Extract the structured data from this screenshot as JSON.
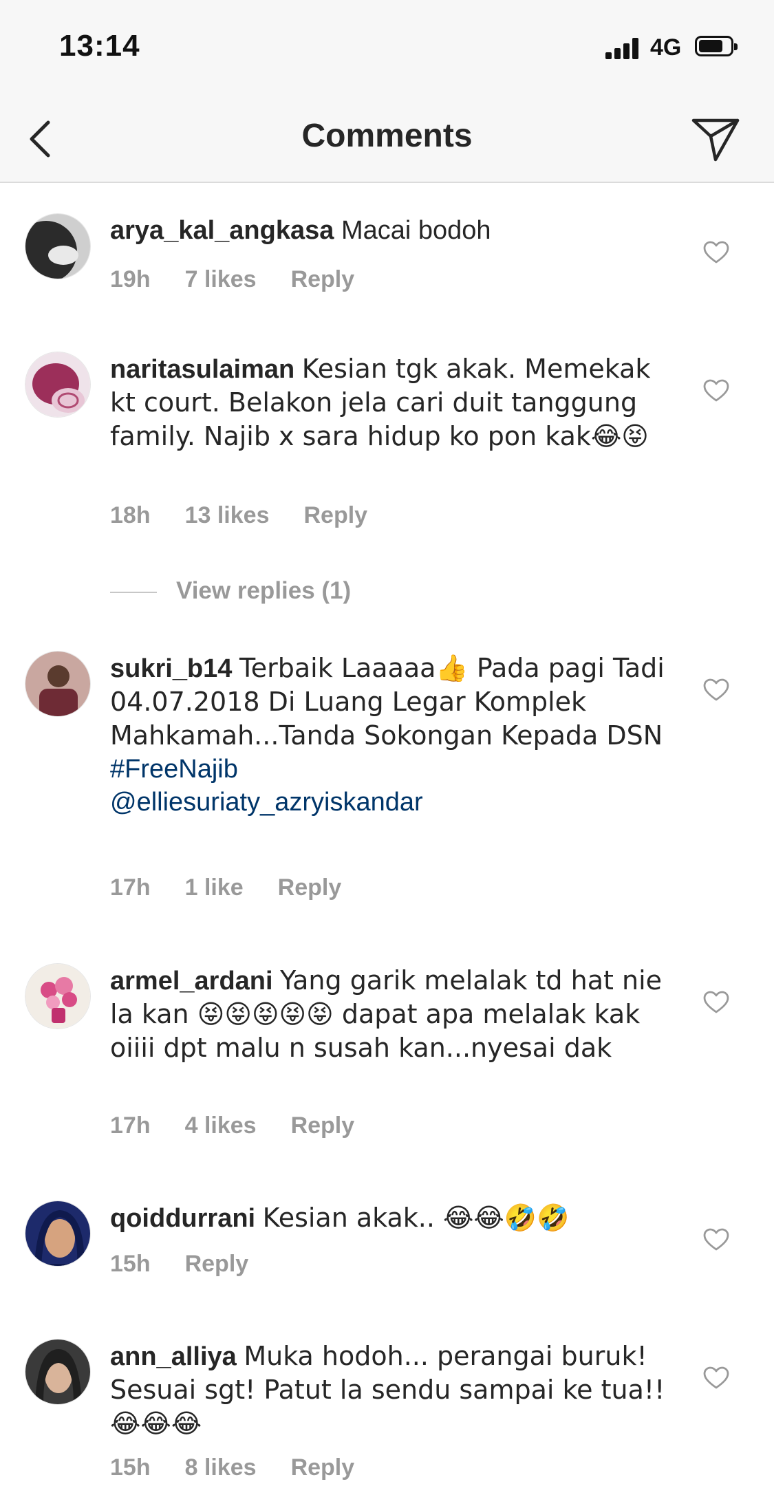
{
  "status": {
    "time": "13:14",
    "network": "4G"
  },
  "nav": {
    "title": "Comments"
  },
  "comments": [
    {
      "username": "arya_kal_angkasa",
      "text": "Macai bodoh",
      "time": "19h",
      "likes": "7 likes",
      "reply": "Reply",
      "avatar_colors": [
        "#2b2b2b",
        "#cfcfcf"
      ]
    },
    {
      "username": "naritasulaiman",
      "text": "Kesian tgk akak. Memekak kt court. Belakon jela cari duit tanggung family.  Najib x sara hidup ko pon kak😂😝",
      "time": "18h",
      "likes": "13 likes",
      "reply": "Reply",
      "avatar_colors": [
        "#9c2f5a",
        "#e8c6d6"
      ]
    },
    {
      "username": "sukri_b14",
      "text": "Terbaik Laaaaa👍 Pada pagi Tadi 04.07.2018 Di Luang Legar Komplek Mahkamah...Tanda Sokongan Kepada DSN",
      "tags": [
        "#FreeNajib",
        "@elliesuriaty_azryiskandar"
      ],
      "time": "17h",
      "likes": "1 like",
      "reply": "Reply",
      "avatar_colors": [
        "#6e2b35",
        "#c9a7a0"
      ]
    },
    {
      "username": "armel_ardani",
      "text": "Yang garik melalak td hat nie la kan 😝😝😝😝😝 dapat apa melalak kak oiiii dpt malu n susah kan...nyesai dak",
      "time": "17h",
      "likes": "4 likes",
      "reply": "Reply",
      "avatar_colors": [
        "#d84c86",
        "#f2ede6"
      ]
    },
    {
      "username": "qoiddurrani",
      "text": "Kesian akak.. 😂😂🤣🤣",
      "time": "15h",
      "likes": "",
      "reply": "Reply",
      "avatar_colors": [
        "#1d2a6b",
        "#d6a37f"
      ]
    },
    {
      "username": "ann_alliya",
      "text": "Muka hodoh... perangai buruk! Sesuai sgt! Patut la sendu sampai ke tua!! 😂😂😂",
      "time": "15h",
      "likes": "8 likes",
      "reply": "Reply",
      "avatar_colors": [
        "#1f1f1f",
        "#d9b49a"
      ]
    }
  ],
  "view_replies": "View replies (1)",
  "icons": {
    "back": "chevron-left-icon",
    "send": "paper-plane-icon",
    "like": "heart-outline-icon"
  }
}
